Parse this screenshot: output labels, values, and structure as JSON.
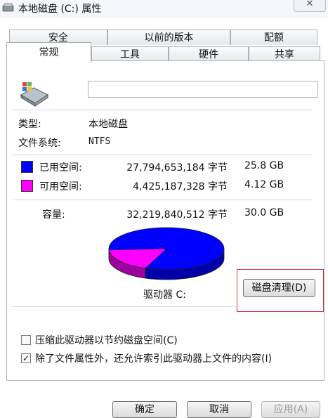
{
  "window": {
    "title": "本地磁盘 (C:) 属性",
    "close_label": "✕"
  },
  "tabs_row1": [
    "安全",
    "以前的版本",
    "配额"
  ],
  "tabs_row2": [
    "常规",
    "工具",
    "硬件",
    "共享"
  ],
  "general": {
    "volume_label_value": "",
    "type_label": "类型:",
    "type_value": "本地磁盘",
    "fs_label": "文件系统:",
    "fs_value": "NTFS",
    "used": {
      "label": "已用空间:",
      "bytes": "27,794,653,184 字节",
      "size": "25.8 GB",
      "color": "#0000ff"
    },
    "free": {
      "label": "可用空间:",
      "bytes": "4,425,187,328 字节",
      "size": "4.12 GB",
      "color": "#ff00ff"
    },
    "capacity": {
      "label": "容量:",
      "bytes": "32,219,840,512 字节",
      "size": "30.0 GB"
    },
    "drive_label": "驱动器 C:",
    "cleanup_button": "磁盘清理(D)",
    "compress_option": {
      "label": "压缩此驱动器以节约磁盘空间(C)",
      "checked": false
    },
    "index_option": {
      "label": "除了文件属性外，还允许索引此驱动器上文件的内容(I)",
      "checked": true
    }
  },
  "footer": {
    "ok": "确定",
    "cancel": "取消",
    "apply": "应用(A)"
  },
  "pie": {
    "used_fraction": 0.863
  }
}
